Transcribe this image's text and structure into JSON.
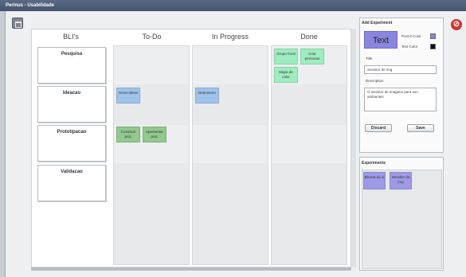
{
  "window": {
    "title": "Perinus - Usabilidade"
  },
  "board": {
    "columns": [
      {
        "title": "BLI's"
      },
      {
        "title": "To-Do"
      },
      {
        "title": "In Progress"
      },
      {
        "title": "Done"
      }
    ],
    "rows": [
      {
        "label": "Pesquisa"
      },
      {
        "label": "Ideacao"
      },
      {
        "label": "Prototipacao"
      },
      {
        "label": "Validacao"
      }
    ],
    "notes": [
      {
        "text": "Grupo focal",
        "color": "#9eedc0"
      },
      {
        "text": "Criar personas",
        "color": "#9eedc0"
      },
      {
        "text": "Mapa de calor",
        "color": "#9eedc0"
      },
      {
        "text": "Gerar ideias",
        "color": "#9fc3ea"
      },
      {
        "text": "Brainstorm",
        "color": "#9fc3ea"
      },
      {
        "text": "Construir prot.",
        "color": "#91c98f"
      },
      {
        "text": "Apresentar prot.",
        "color": "#91c98f"
      }
    ]
  },
  "add_experiment": {
    "title": "Add Experiment",
    "preview_text": "Text",
    "post_it_color_label": "Post-it Color",
    "post_it_color": "#8a86e0",
    "text_color_label": "Text Color",
    "text_color": "#111111",
    "title_label": "Title",
    "title_value": "Sensitor de img",
    "description_label": "Description",
    "description_value": "O sensitor de imagens para uso ambientes",
    "discard_label": "Discard",
    "save_label": "Save"
  },
  "experiments": {
    "title": "Experiments",
    "items": [
      {
        "text": "Blt test do ui",
        "color": "#9f9ae6"
      },
      {
        "text": "Sensitor de img",
        "color": "#9f9ae6"
      }
    ]
  },
  "colors": {
    "titlebar": "#4a5a75",
    "close_button": "#d8302a",
    "accent_purple": "#8a86e0"
  }
}
